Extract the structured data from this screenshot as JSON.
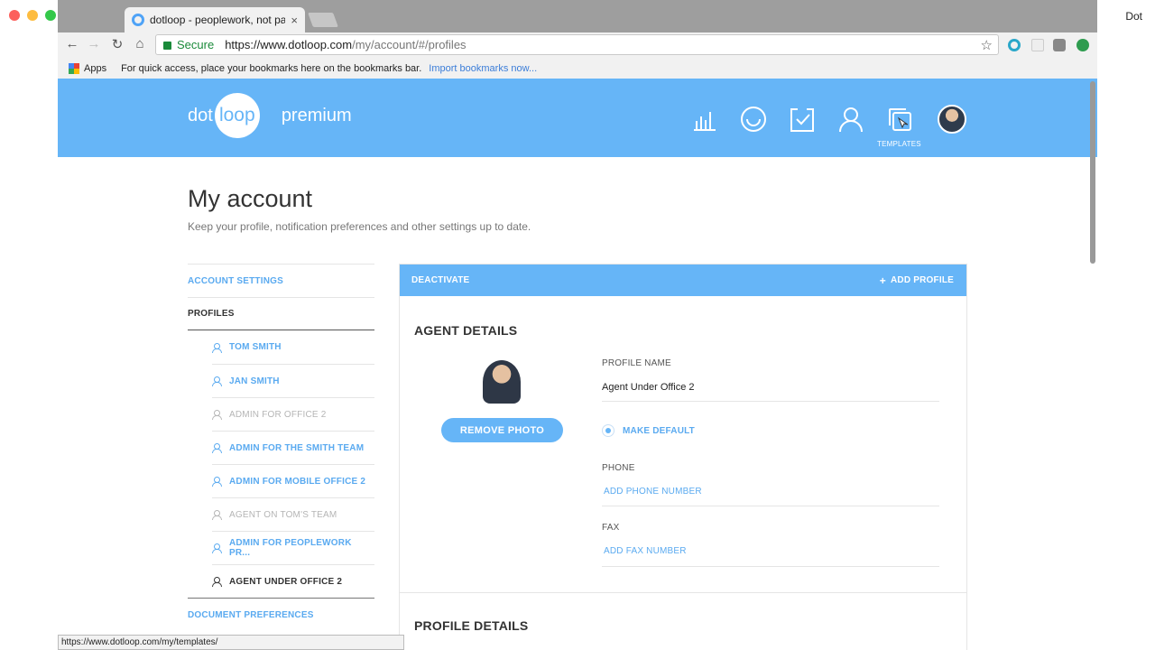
{
  "browser": {
    "tab_title": "dotloop - peoplework, not pap",
    "tab_close": "×",
    "window_name": "Dot",
    "secure_label": "Secure",
    "url_host": "https://www.dotloop.com",
    "url_path": "/my/account/#/profiles",
    "bookmarks_apps": "Apps",
    "bookmarks_hint": "For quick access, place your bookmarks here on the bookmarks bar.",
    "bookmarks_import": "Import bookmarks now...",
    "status_url": "https://www.dotloop.com/my/templates/"
  },
  "header": {
    "logo_left": "dot",
    "logo_circle": "loop",
    "logo_tier": "premium",
    "templates_label": "TEMPLATES",
    "brand_color": "#66b5f7"
  },
  "page": {
    "title": "My account",
    "subtitle": "Keep your profile, notification preferences and other settings up to date."
  },
  "sidebar": {
    "account_settings": "ACCOUNT SETTINGS",
    "profiles": "PROFILES",
    "profile_items": [
      {
        "label": "TOM SMITH",
        "state": "link"
      },
      {
        "label": "JAN SMITH",
        "state": "link"
      },
      {
        "label": "ADMIN FOR OFFICE 2",
        "state": "muted"
      },
      {
        "label": "ADMIN FOR THE SMITH TEAM",
        "state": "link"
      },
      {
        "label": "ADMIN FOR MOBILE OFFICE 2",
        "state": "link"
      },
      {
        "label": "AGENT ON TOM'S TEAM",
        "state": "muted"
      },
      {
        "label": "ADMIN FOR PEOPLEWORK PR...",
        "state": "link"
      },
      {
        "label": "AGENT UNDER OFFICE 2",
        "state": "current"
      }
    ],
    "document_preferences": "DOCUMENT PREFERENCES"
  },
  "card": {
    "deactivate": "DEACTIVATE",
    "add_profile": "ADD PROFILE",
    "agent_details_title": "AGENT DETAILS",
    "remove_photo": "REMOVE PHOTO",
    "profile_name_label": "PROFILE NAME",
    "profile_name_value": "Agent Under Office 2",
    "make_default": "MAKE DEFAULT",
    "phone_label": "PHONE",
    "add_phone": "ADD PHONE NUMBER",
    "fax_label": "FAX",
    "add_fax": "ADD FAX NUMBER",
    "profile_details_title": "PROFILE DETAILS"
  }
}
